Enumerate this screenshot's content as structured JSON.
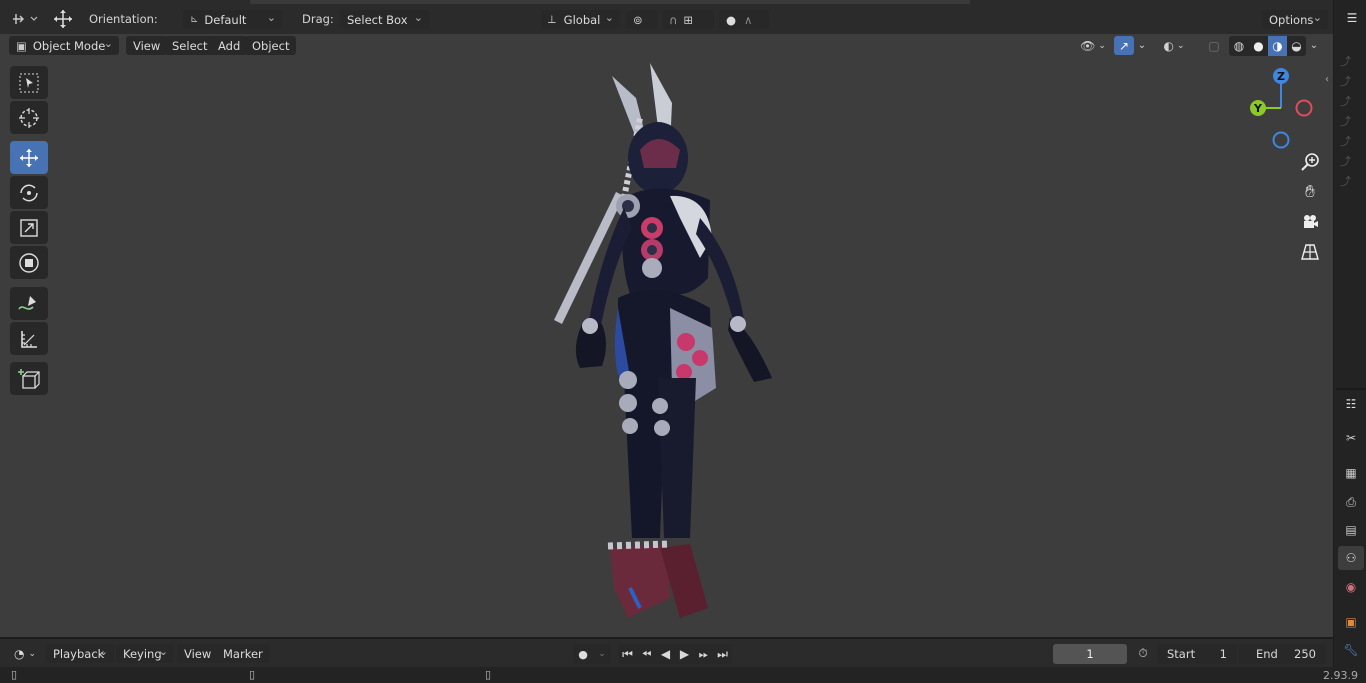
{
  "header": {
    "orientation_label": "Orientation:",
    "orientation_value": "Default",
    "drag_label": "Drag:",
    "drag_value": "Select Box",
    "transform_space": "Global",
    "options_label": "Options"
  },
  "viewport_header": {
    "mode": "Object Mode",
    "menus": [
      "View",
      "Select",
      "Add",
      "Object"
    ]
  },
  "gizmo": {
    "axis_z": "Z",
    "axis_y": "Y"
  },
  "timeline": {
    "menus": [
      "Playback",
      "Keying",
      "View",
      "Marker"
    ],
    "current_frame": "1",
    "start_label": "Start",
    "start_value": "1",
    "end_label": "End",
    "end_value": "250"
  },
  "status": {
    "version": "2.93.9"
  },
  "icons": {
    "tools": [
      "select-box-icon",
      "cursor-icon",
      "move-icon",
      "rotate-icon",
      "scale-icon",
      "transform-icon",
      "annotate-icon",
      "measure-icon",
      "add-cube-icon"
    ],
    "navigation": [
      "zoom-icon",
      "pan-hand-icon",
      "camera-icon",
      "grid-view-icon"
    ],
    "properties_tabs": [
      "tool-icon",
      "render-icon",
      "output-icon",
      "view-layer-icon",
      "scene-icon",
      "world-icon",
      "object-icon",
      "modifier-icon"
    ]
  },
  "colors": {
    "viewport_bg": "#3d3d3d",
    "active_tool": "#4772b3",
    "axis_x": "#e14b5a",
    "axis_y": "#8ac926",
    "axis_z": "#3f86e0"
  }
}
